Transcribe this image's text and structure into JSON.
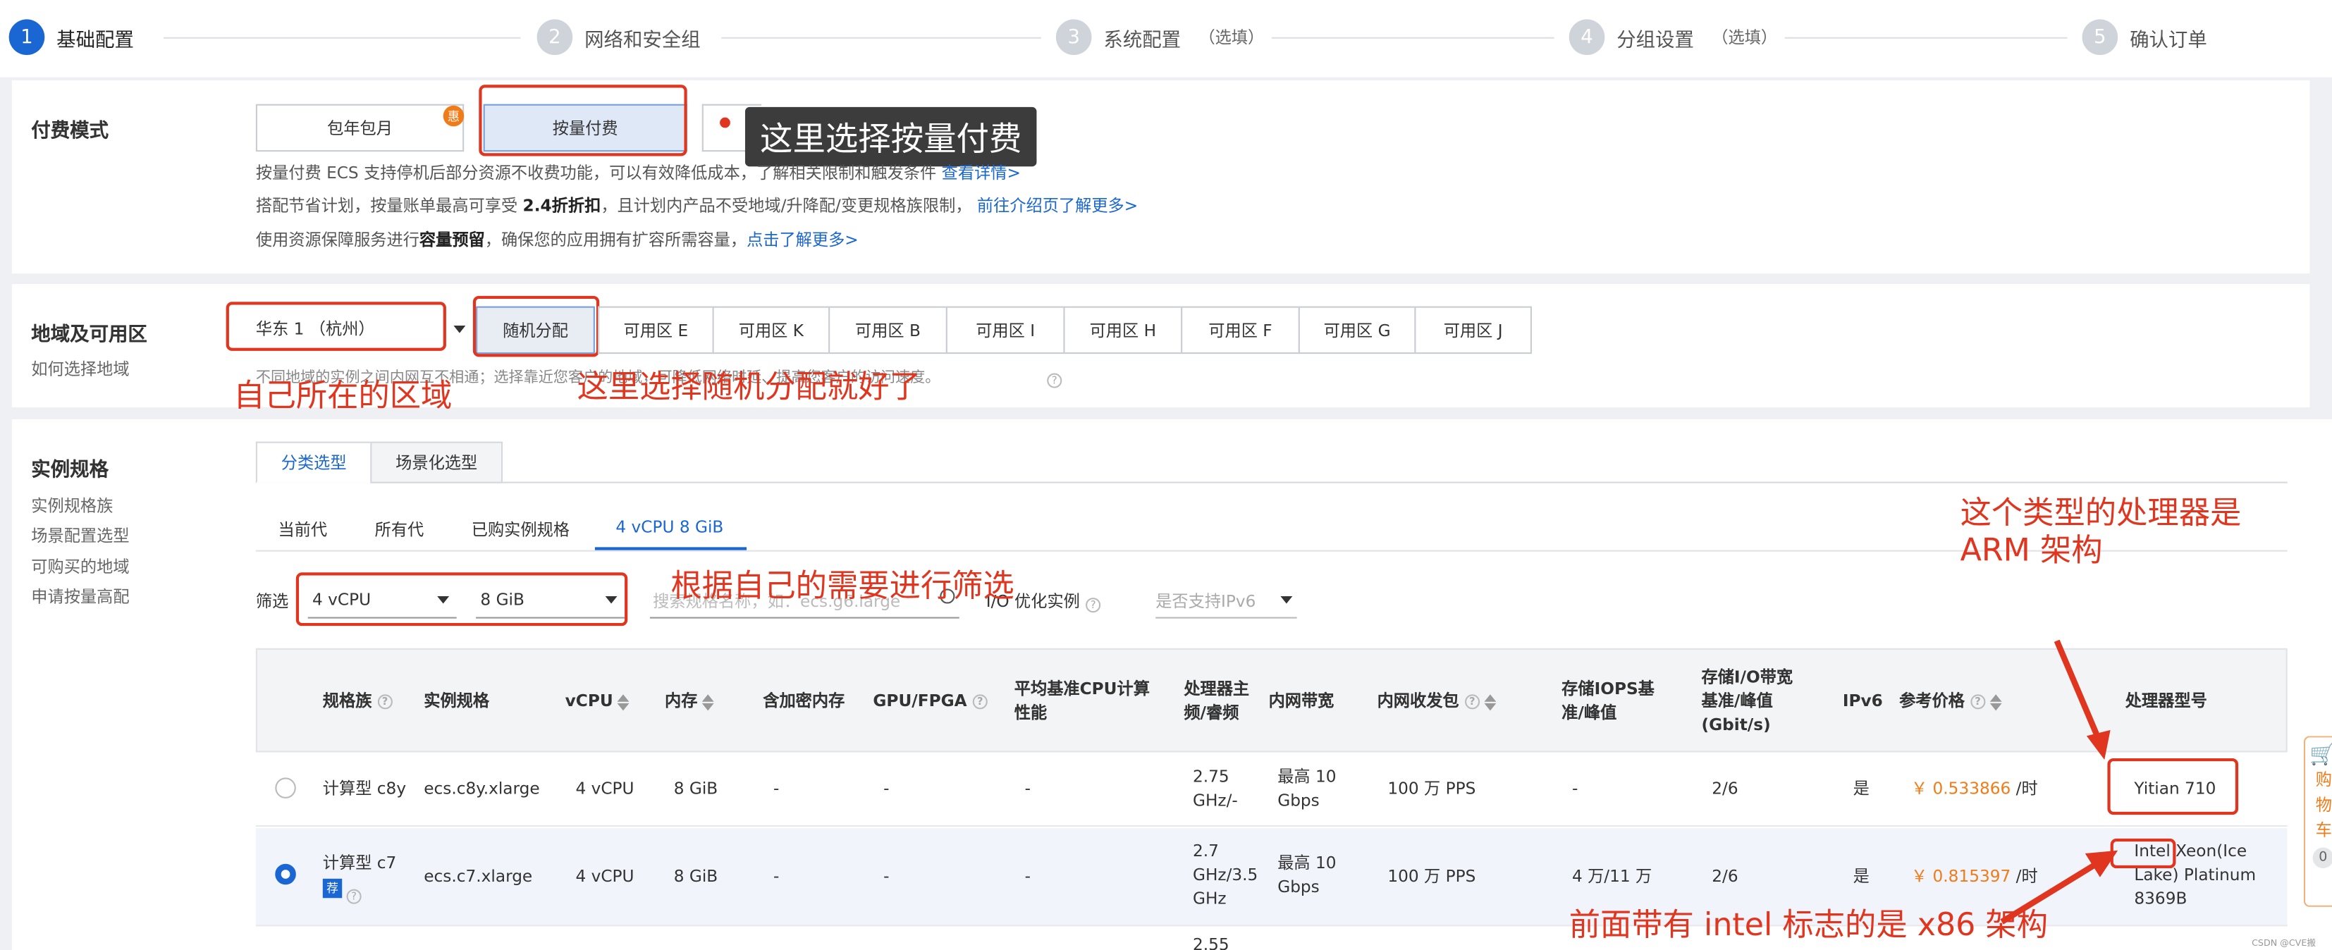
{
  "steps": [
    {
      "num": "1",
      "label": "基础配置",
      "optional": ""
    },
    {
      "num": "2",
      "label": "网络和安全组",
      "optional": ""
    },
    {
      "num": "3",
      "label": "系统配置",
      "optional": "（选填）"
    },
    {
      "num": "4",
      "label": "分组设置",
      "optional": "（选填）"
    },
    {
      "num": "5",
      "label": "确认订单",
      "optional": ""
    }
  ],
  "billing": {
    "title": "付费模式",
    "option_monthly": "包年包月",
    "monthly_badge": "惠",
    "option_payg": "按量付费",
    "desc1": "按量付费 ECS 支持停机后部分资源不收费功能，可以有效降低成本，了解相关限制和触发条件",
    "desc1_link": "查看详情>",
    "desc2_pre": "搭配节省计划，按量账单最高可享受",
    "desc2_bold": "2.4折折扣",
    "desc2_post": "，且计划内产品不受地域/升降配/变更规格族限制，",
    "desc2_link": "前往介绍页了解更多>",
    "desc3_pre": "使用资源保障服务进行",
    "desc3_bold": "容量预留",
    "desc3_post": "，确保您的应用拥有扩容所需容量，",
    "desc3_link": "点击了解更多>",
    "annotation": "这里选择按量付费"
  },
  "region": {
    "title": "地域及可用区",
    "help": "如何选择地域",
    "selected": "华东 1 （杭州）",
    "zones": [
      "随机分配",
      "可用区 E",
      "可用区 K",
      "可用区 B",
      "可用区 I",
      "可用区 H",
      "可用区 F",
      "可用区 G",
      "可用区 J"
    ],
    "note": "不同地域的实例之间内网互不相通；选择靠近您客户的地域，可降低网络时延、提高您客户的访问速度。",
    "annotation_region": "自己所在的区域",
    "annotation_zone": "这里选择随机分配就好了"
  },
  "spec": {
    "title": "实例规格",
    "links": [
      "实例规格族",
      "场景配置选型",
      "可购买的地域",
      "申请按量高配"
    ],
    "tabs": [
      "分类选型",
      "场景化选型"
    ],
    "subtabs": [
      "当前代",
      "所有代",
      "已购实例规格",
      "4 vCPU 8 GiB"
    ],
    "filter_label": "筛选",
    "vcpu": "4 vCPU",
    "mem": "8 GiB",
    "search_placeholder": "搜索规格名称，如：ecs.g6.large",
    "io_opt": "I/O 优化实例",
    "ipv6_placeholder": "是否支持IPv6",
    "annotation_filter": "根据自己的需要进行筛选",
    "annotation_arm": "这个类型的处理器是\nARM 架构",
    "annotation_x86": "前面带有 intel 标志的是 x86 架构"
  },
  "table": {
    "headers": {
      "family": "规格族",
      "spec": "实例规格",
      "vcpu": "vCPU",
      "mem": "内存",
      "enc": "含加密内存",
      "gpu": "GPU/FPGA",
      "baseline": "平均基准CPU计算性能",
      "freq": "处理器主频/睿频",
      "bw": "内网带宽",
      "pps": "内网收发包",
      "iops": "存储IOPS基准/峰值",
      "io_bw": "存储I/O带宽基准/峰值(Gbit/s)",
      "ipv6": "IPv6",
      "price": "参考价格",
      "cpu": "处理器型号"
    },
    "rows": [
      {
        "family": "计算型 c8y",
        "spec": "ecs.c8y.xlarge",
        "vcpu": "4 vCPU",
        "mem": "8 GiB",
        "enc": "-",
        "gpu": "-",
        "baseline": "-",
        "freq": "2.75 GHz/-",
        "bw": "最高 10 Gbps",
        "pps": "100 万 PPS",
        "iops": "-",
        "io_bw": "2/6",
        "ipv6": "是",
        "price": "￥ 0.533866",
        "unit": "/时",
        "cpu": "Yitian 710",
        "selected": false,
        "recommended": ""
      },
      {
        "family": "计算型 c7",
        "spec": "ecs.c7.xlarge",
        "vcpu": "4 vCPU",
        "mem": "8 GiB",
        "enc": "-",
        "gpu": "-",
        "baseline": "-",
        "freq": "2.7 GHz/3.5 GHz",
        "bw": "最高 10 Gbps",
        "pps": "100 万 PPS",
        "iops": "4 万/11 万",
        "io_bw": "2/6",
        "ipv6": "是",
        "price": "￥ 0.815397",
        "unit": "/时",
        "cpu": "Intel Xeon(Ice Lake) Platinum 8369B",
        "selected": true,
        "recommended": "荐"
      },
      {
        "freq": "2.55"
      }
    ]
  },
  "cart": {
    "label": "购物车",
    "count": "0"
  },
  "watermark": "CSDN @CVE搬"
}
